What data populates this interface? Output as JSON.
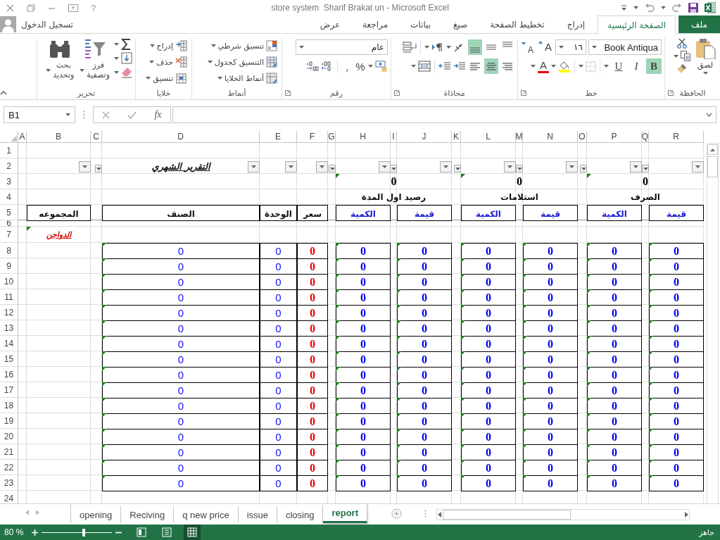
{
  "title_bar": {
    "help": "?",
    "title": "store system  Sharif Brakat un - Microsoft Excel"
  },
  "ribbon_tabs": [
    {
      "label": "ملف",
      "kind": "file",
      "selected": false
    },
    {
      "label": "الصفحة الرئيسية",
      "kind": "tab",
      "selected": true
    },
    {
      "label": "إدراج",
      "kind": "tab",
      "selected": false
    },
    {
      "label": "تخطيط الصفحة",
      "kind": "tab",
      "selected": false
    },
    {
      "label": "صيغ",
      "kind": "tab",
      "selected": false
    },
    {
      "label": "بيانات",
      "kind": "tab",
      "selected": false
    },
    {
      "label": "مراجعة",
      "kind": "tab",
      "selected": false
    },
    {
      "label": "عرض",
      "kind": "tab",
      "selected": false
    }
  ],
  "account": {
    "label": "تسجيل الدخول"
  },
  "ribbon_groups": [
    {
      "kind": "clipboard",
      "label": "الحافظة",
      "paste": "لصق"
    },
    {
      "kind": "font",
      "label": "خط",
      "font_name": "Book Antiqua",
      "font_size": "١٦",
      "grow": "A",
      "shrink": "A",
      "font_color": "A",
      "styles": [
        {
          "label": "B",
          "selected": true
        },
        {
          "label": "I",
          "selected": false
        },
        {
          "label": "U",
          "selected": false
        }
      ]
    },
    {
      "kind": "alignment",
      "label": "محاذاة",
      "vertical": [
        {
          "selected": false
        },
        {
          "selected": false
        },
        {
          "selected": true
        }
      ],
      "horizontal": [
        {
          "selected": false
        },
        {
          "selected": true
        },
        {
          "selected": false
        }
      ]
    },
    {
      "kind": "number",
      "label": "رقم",
      "format": "عام",
      "percent": "%",
      "comma": ","
    },
    {
      "kind": "styles",
      "label": "أنماط",
      "items": [
        "تنسيق شرطي",
        "التنسيق كجدول",
        "أنماط الخلايا"
      ]
    },
    {
      "kind": "cells",
      "label": "خلايا",
      "items": [
        "إدراج",
        "حذف",
        "تنسيق"
      ]
    },
    {
      "kind": "editing",
      "label": "تحرير",
      "items": [
        {
          "lines": [
            "فرز",
            "وتصفية"
          ]
        },
        {
          "lines": [
            "بحث",
            "وتحديد"
          ]
        }
      ]
    }
  ],
  "formula_bar": {
    "name_box": "B1",
    "fx": "fx"
  },
  "sheet": {
    "columns": [
      {
        "letter": "R",
        "filter": true
      },
      {
        "letter": "Q",
        "filter": true
      },
      {
        "letter": "P",
        "filter": true
      },
      {
        "letter": "O",
        "filter": true
      },
      {
        "letter": "N",
        "filter": true
      },
      {
        "letter": "M",
        "filter": true
      },
      {
        "letter": "L",
        "filter": true
      },
      {
        "letter": "K",
        "filter": true
      },
      {
        "letter": "J",
        "filter": true
      },
      {
        "letter": "I",
        "filter": true
      },
      {
        "letter": "H",
        "filter": true
      },
      {
        "letter": "G",
        "filter": true
      },
      {
        "letter": "F",
        "filter": true
      },
      {
        "letter": "E",
        "filter": true
      },
      {
        "letter": "D",
        "filter": true
      },
      {
        "letter": "C",
        "filter": true
      },
      {
        "letter": "B",
        "filter": true
      },
      {
        "letter": "A",
        "filter": false
      }
    ],
    "rows": [
      {
        "header": "1"
      },
      {
        "header": "2",
        "D": {
          "kind": "title",
          "text": "التقرير الشهري"
        }
      },
      {
        "header": "3",
        "H-J": {
          "kind": "total",
          "text": "0",
          "flag": true
        },
        "L-N": {
          "kind": "total",
          "text": "0",
          "flag": true
        },
        "P-R": {
          "kind": "total",
          "text": "0",
          "flag": true
        }
      },
      {
        "header": "4",
        "H-J": {
          "kind": "group",
          "text": "رصيد اول المدة"
        },
        "L-N": {
          "kind": "group",
          "text": "استلامات"
        },
        "P-R": {
          "kind": "group",
          "text": "الصرف"
        }
      },
      {
        "header": "5",
        "B": {
          "kind": "header",
          "text": "المجموعه"
        },
        "D": {
          "kind": "header",
          "text": "الصنف"
        },
        "E": {
          "kind": "header",
          "text": "الوحدة"
        },
        "F": {
          "kind": "header",
          "text": "سعر"
        },
        "H": {
          "kind": "subheader",
          "text": "الكمية"
        },
        "J": {
          "kind": "subheader",
          "text": "قيمة"
        },
        "L": {
          "kind": "subheader",
          "text": "الكمية"
        },
        "N": {
          "kind": "subheader",
          "text": "قيمة"
        },
        "P": {
          "kind": "subheader",
          "text": "الكمية"
        },
        "R": {
          "kind": "subheader",
          "text": "قيمة"
        }
      },
      {
        "header": "6"
      },
      {
        "header": "7",
        "B": {
          "kind": "category",
          "text": "الدواجن",
          "flag": true
        }
      },
      {
        "header": "8",
        "D": {
          "kind": "item",
          "text": "0",
          "flag": true
        },
        "E": {
          "kind": "item",
          "text": "0"
        },
        "F": {
          "kind": "price",
          "text": "0"
        },
        "H": {
          "kind": "amount",
          "text": "0",
          "flag": true
        },
        "J": {
          "kind": "amount",
          "text": "0",
          "flag": true
        },
        "L": {
          "kind": "amount",
          "text": "0",
          "flag": true
        },
        "N": {
          "kind": "amount",
          "text": "0",
          "flag": true
        },
        "P": {
          "kind": "amount",
          "text": "0",
          "flag": true
        },
        "R": {
          "kind": "amount",
          "text": "0",
          "flag": true
        }
      },
      {
        "header": "9",
        "D": {
          "kind": "item",
          "text": "0",
          "flag": true
        },
        "E": {
          "kind": "item",
          "text": "0"
        },
        "F": {
          "kind": "price",
          "text": "0"
        },
        "H": {
          "kind": "amount",
          "text": "0",
          "flag": true
        },
        "J": {
          "kind": "amount",
          "text": "0",
          "flag": true
        },
        "L": {
          "kind": "amount",
          "text": "0",
          "flag": true
        },
        "N": {
          "kind": "amount",
          "text": "0",
          "flag": true
        },
        "P": {
          "kind": "amount",
          "text": "0",
          "flag": true
        },
        "R": {
          "kind": "amount",
          "text": "0",
          "flag": true
        }
      },
      {
        "header": "10",
        "D": {
          "kind": "item",
          "text": "0",
          "flag": true
        },
        "E": {
          "kind": "item",
          "text": "0"
        },
        "F": {
          "kind": "price",
          "text": "0"
        },
        "H": {
          "kind": "amount",
          "text": "0",
          "flag": true
        },
        "J": {
          "kind": "amount",
          "text": "0",
          "flag": true
        },
        "L": {
          "kind": "amount",
          "text": "0",
          "flag": true
        },
        "N": {
          "kind": "amount",
          "text": "0",
          "flag": true
        },
        "P": {
          "kind": "amount",
          "text": "0",
          "flag": true
        },
        "R": {
          "kind": "amount",
          "text": "0",
          "flag": true
        }
      },
      {
        "header": "11",
        "D": {
          "kind": "item",
          "text": "0",
          "flag": true
        },
        "E": {
          "kind": "item",
          "text": "0"
        },
        "F": {
          "kind": "price",
          "text": "0"
        },
        "H": {
          "kind": "amount",
          "text": "0",
          "flag": true
        },
        "J": {
          "kind": "amount",
          "text": "0",
          "flag": true
        },
        "L": {
          "kind": "amount",
          "text": "0",
          "flag": true
        },
        "N": {
          "kind": "amount",
          "text": "0",
          "flag": true
        },
        "P": {
          "kind": "amount",
          "text": "0",
          "flag": true
        },
        "R": {
          "kind": "amount",
          "text": "0",
          "flag": true
        }
      },
      {
        "header": "12",
        "D": {
          "kind": "item",
          "text": "0",
          "flag": true
        },
        "E": {
          "kind": "item",
          "text": "0"
        },
        "F": {
          "kind": "price",
          "text": "0"
        },
        "H": {
          "kind": "amount",
          "text": "0",
          "flag": true
        },
        "J": {
          "kind": "amount",
          "text": "0",
          "flag": true
        },
        "L": {
          "kind": "amount",
          "text": "0",
          "flag": true
        },
        "N": {
          "kind": "amount",
          "text": "0",
          "flag": true
        },
        "P": {
          "kind": "amount",
          "text": "0",
          "flag": true
        },
        "R": {
          "kind": "amount",
          "text": "0",
          "flag": true
        }
      },
      {
        "header": "13",
        "D": {
          "kind": "item",
          "text": "0",
          "flag": true
        },
        "E": {
          "kind": "item",
          "text": "0"
        },
        "F": {
          "kind": "price",
          "text": "0"
        },
        "H": {
          "kind": "amount",
          "text": "0",
          "flag": true
        },
        "J": {
          "kind": "amount",
          "text": "0",
          "flag": true
        },
        "L": {
          "kind": "amount",
          "text": "0",
          "flag": true
        },
        "N": {
          "kind": "amount",
          "text": "0",
          "flag": true
        },
        "P": {
          "kind": "amount",
          "text": "0",
          "flag": true
        },
        "R": {
          "kind": "amount",
          "text": "0",
          "flag": true
        }
      },
      {
        "header": "14",
        "D": {
          "kind": "item",
          "text": "0",
          "flag": true
        },
        "E": {
          "kind": "item",
          "text": "0"
        },
        "F": {
          "kind": "price",
          "text": "0"
        },
        "H": {
          "kind": "amount",
          "text": "0",
          "flag": true
        },
        "J": {
          "kind": "amount",
          "text": "0",
          "flag": true
        },
        "L": {
          "kind": "amount",
          "text": "0",
          "flag": true
        },
        "N": {
          "kind": "amount",
          "text": "0",
          "flag": true
        },
        "P": {
          "kind": "amount",
          "text": "0",
          "flag": true
        },
        "R": {
          "kind": "amount",
          "text": "0",
          "flag": true
        }
      },
      {
        "header": "15",
        "D": {
          "kind": "item",
          "text": "0",
          "flag": true
        },
        "E": {
          "kind": "item",
          "text": "0"
        },
        "F": {
          "kind": "price",
          "text": "0"
        },
        "H": {
          "kind": "amount",
          "text": "0",
          "flag": true
        },
        "J": {
          "kind": "amount",
          "text": "0",
          "flag": true
        },
        "L": {
          "kind": "amount",
          "text": "0",
          "flag": true
        },
        "N": {
          "kind": "amount",
          "text": "0",
          "flag": true
        },
        "P": {
          "kind": "amount",
          "text": "0",
          "flag": true
        },
        "R": {
          "kind": "amount",
          "text": "0",
          "flag": true
        }
      },
      {
        "header": "16",
        "D": {
          "kind": "item",
          "text": "0",
          "flag": true
        },
        "E": {
          "kind": "item",
          "text": "0"
        },
        "F": {
          "kind": "price",
          "text": "0"
        },
        "H": {
          "kind": "amount",
          "text": "0",
          "flag": true
        },
        "J": {
          "kind": "amount",
          "text": "0",
          "flag": true
        },
        "L": {
          "kind": "amount",
          "text": "0",
          "flag": true
        },
        "N": {
          "kind": "amount",
          "text": "0",
          "flag": true
        },
        "P": {
          "kind": "amount",
          "text": "0",
          "flag": true
        },
        "R": {
          "kind": "amount",
          "text": "0",
          "flag": true
        }
      },
      {
        "header": "17",
        "D": {
          "kind": "item",
          "text": "0",
          "flag": true
        },
        "E": {
          "kind": "item",
          "text": "0"
        },
        "F": {
          "kind": "price",
          "text": "0"
        },
        "H": {
          "kind": "amount",
          "text": "0",
          "flag": true
        },
        "J": {
          "kind": "amount",
          "text": "0",
          "flag": true
        },
        "L": {
          "kind": "amount",
          "text": "0",
          "flag": true
        },
        "N": {
          "kind": "amount",
          "text": "0",
          "flag": true
        },
        "P": {
          "kind": "amount",
          "text": "0",
          "flag": true
        },
        "R": {
          "kind": "amount",
          "text": "0",
          "flag": true
        }
      },
      {
        "header": "18",
        "D": {
          "kind": "item",
          "text": "0",
          "flag": true
        },
        "E": {
          "kind": "item",
          "text": "0"
        },
        "F": {
          "kind": "price",
          "text": "0"
        },
        "H": {
          "kind": "amount",
          "text": "0",
          "flag": true
        },
        "J": {
          "kind": "amount",
          "text": "0",
          "flag": true
        },
        "L": {
          "kind": "amount",
          "text": "0",
          "flag": true
        },
        "N": {
          "kind": "amount",
          "text": "0",
          "flag": true
        },
        "P": {
          "kind": "amount",
          "text": "0",
          "flag": true
        },
        "R": {
          "kind": "amount",
          "text": "0",
          "flag": true
        }
      },
      {
        "header": "19",
        "D": {
          "kind": "item",
          "text": "0",
          "flag": true
        },
        "E": {
          "kind": "item",
          "text": "0"
        },
        "F": {
          "kind": "price",
          "text": "0"
        },
        "H": {
          "kind": "amount",
          "text": "0",
          "flag": true
        },
        "J": {
          "kind": "amount",
          "text": "0",
          "flag": true
        },
        "L": {
          "kind": "amount",
          "text": "0",
          "flag": true
        },
        "N": {
          "kind": "amount",
          "text": "0",
          "flag": true
        },
        "P": {
          "kind": "amount",
          "text": "0",
          "flag": true
        },
        "R": {
          "kind": "amount",
          "text": "0",
          "flag": true
        }
      },
      {
        "header": "20",
        "D": {
          "kind": "item",
          "text": "0",
          "flag": true
        },
        "E": {
          "kind": "item",
          "text": "0"
        },
        "F": {
          "kind": "price",
          "text": "0"
        },
        "H": {
          "kind": "amount",
          "text": "0",
          "flag": true
        },
        "J": {
          "kind": "amount",
          "text": "0",
          "flag": true
        },
        "L": {
          "kind": "amount",
          "text": "0",
          "flag": true
        },
        "N": {
          "kind": "amount",
          "text": "0",
          "flag": true
        },
        "P": {
          "kind": "amount",
          "text": "0",
          "flag": true
        },
        "R": {
          "kind": "amount",
          "text": "0",
          "flag": true
        }
      },
      {
        "header": "21",
        "D": {
          "kind": "item",
          "text": "0",
          "flag": true
        },
        "E": {
          "kind": "item",
          "text": "0"
        },
        "F": {
          "kind": "price",
          "text": "0"
        },
        "H": {
          "kind": "amount",
          "text": "0",
          "flag": true
        },
        "J": {
          "kind": "amount",
          "text": "0",
          "flag": true
        },
        "L": {
          "kind": "amount",
          "text": "0",
          "flag": true
        },
        "N": {
          "kind": "amount",
          "text": "0",
          "flag": true
        },
        "P": {
          "kind": "amount",
          "text": "0",
          "flag": true
        },
        "R": {
          "kind": "amount",
          "text": "0",
          "flag": true
        }
      },
      {
        "header": "22",
        "D": {
          "kind": "item",
          "text": "0",
          "flag": true
        },
        "E": {
          "kind": "item",
          "text": "0"
        },
        "F": {
          "kind": "price",
          "text": "0"
        },
        "H": {
          "kind": "amount",
          "text": "0",
          "flag": true
        },
        "J": {
          "kind": "amount",
          "text": "0",
          "flag": true
        },
        "L": {
          "kind": "amount",
          "text": "0",
          "flag": true
        },
        "N": {
          "kind": "amount",
          "text": "0",
          "flag": true
        },
        "P": {
          "kind": "amount",
          "text": "0",
          "flag": true
        },
        "R": {
          "kind": "amount",
          "text": "0",
          "flag": true
        }
      },
      {
        "header": "23",
        "D": {
          "kind": "item",
          "text": "0",
          "flag": true
        },
        "E": {
          "kind": "item",
          "text": "0"
        },
        "F": {
          "kind": "price",
          "text": "0"
        },
        "H": {
          "kind": "amount",
          "text": "0",
          "flag": true
        },
        "J": {
          "kind": "amount",
          "text": "0",
          "flag": true
        },
        "L": {
          "kind": "amount",
          "text": "0",
          "flag": true
        },
        "N": {
          "kind": "amount",
          "text": "0",
          "flag": true
        },
        "P": {
          "kind": "amount",
          "text": "0",
          "flag": true
        },
        "R": {
          "kind": "amount",
          "text": "0",
          "flag": true
        }
      },
      {
        "header": "24"
      }
    ]
  },
  "sheet_tabs": [
    {
      "label": "report",
      "selected": true
    },
    {
      "label": "closing",
      "selected": false
    },
    {
      "label": "issue",
      "selected": false
    },
    {
      "label": "q new price",
      "selected": false
    },
    {
      "label": "Reciving",
      "selected": false
    },
    {
      "label": "opening",
      "selected": false
    }
  ],
  "status_bar": {
    "zoom": "80 %",
    "zoom_slider": {
      "level": 0.6
    },
    "views": [
      {
        "selected": false
      },
      {
        "selected": false
      },
      {
        "selected": true
      }
    ],
    "status": "جاهز"
  }
}
